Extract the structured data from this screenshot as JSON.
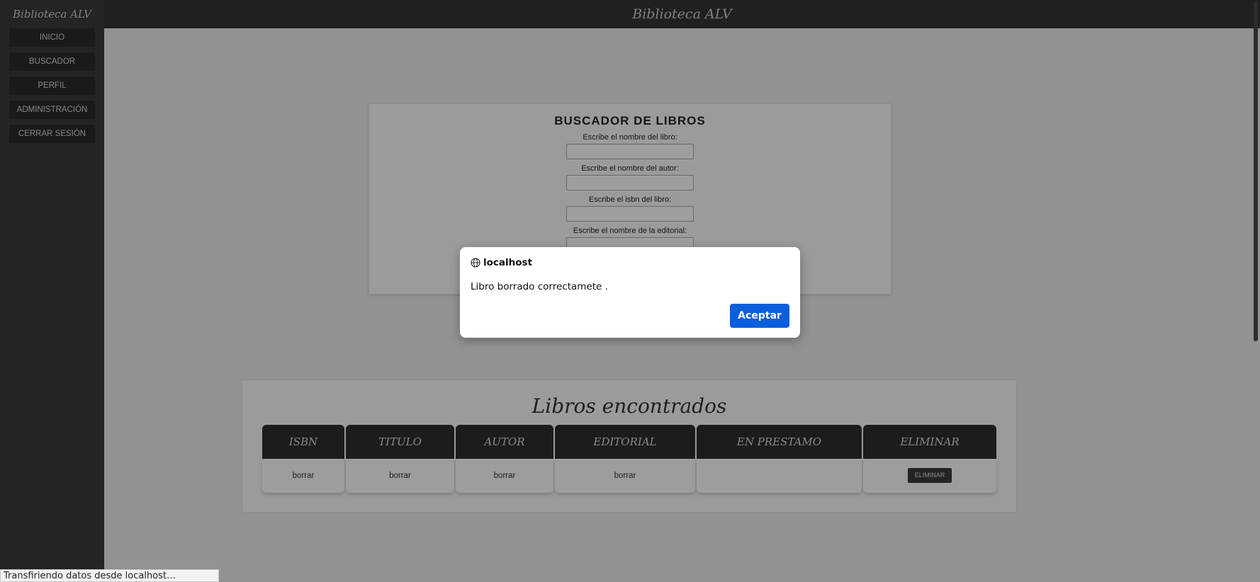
{
  "sidebar": {
    "title": "Biblioteca ALV",
    "items": [
      {
        "label": "INICIO"
      },
      {
        "label": "BUSCADOR"
      },
      {
        "label": "PERFIL"
      },
      {
        "label": "ADMINISTRACIÓN"
      },
      {
        "label": "CERRAR SESIÓN"
      }
    ]
  },
  "header": {
    "title": "Biblioteca ALV"
  },
  "search": {
    "title": "BUSCADOR DE LIBROS",
    "fields": [
      {
        "label": "Escribe el nombre del libro:",
        "value": ""
      },
      {
        "label": "Escribe el nombre del autor:",
        "value": ""
      },
      {
        "label": "Escribe el isbn del libro:",
        "value": ""
      },
      {
        "label": "Escribe el nombre de la editorial:",
        "value": ""
      }
    ]
  },
  "results": {
    "title": "Libros encontrados",
    "columns": [
      "ISBN",
      "TITULO",
      "AUTOR",
      "EDITORIAL",
      "EN PRESTAMO",
      "ELIMINAR"
    ],
    "rows": [
      {
        "isbn": "borrar",
        "titulo": "borrar",
        "autor": "borrar",
        "editorial": "borrar",
        "en_prestamo": "",
        "eliminar_label": "ELIMINAR"
      }
    ]
  },
  "dialog": {
    "origin": "localhost",
    "message": "Libro borrado correctamete .",
    "accept_label": "Aceptar",
    "accent_color": "#0b5fdc"
  },
  "status_bar": {
    "text": "Transfiriendo datos desde localhost…"
  }
}
